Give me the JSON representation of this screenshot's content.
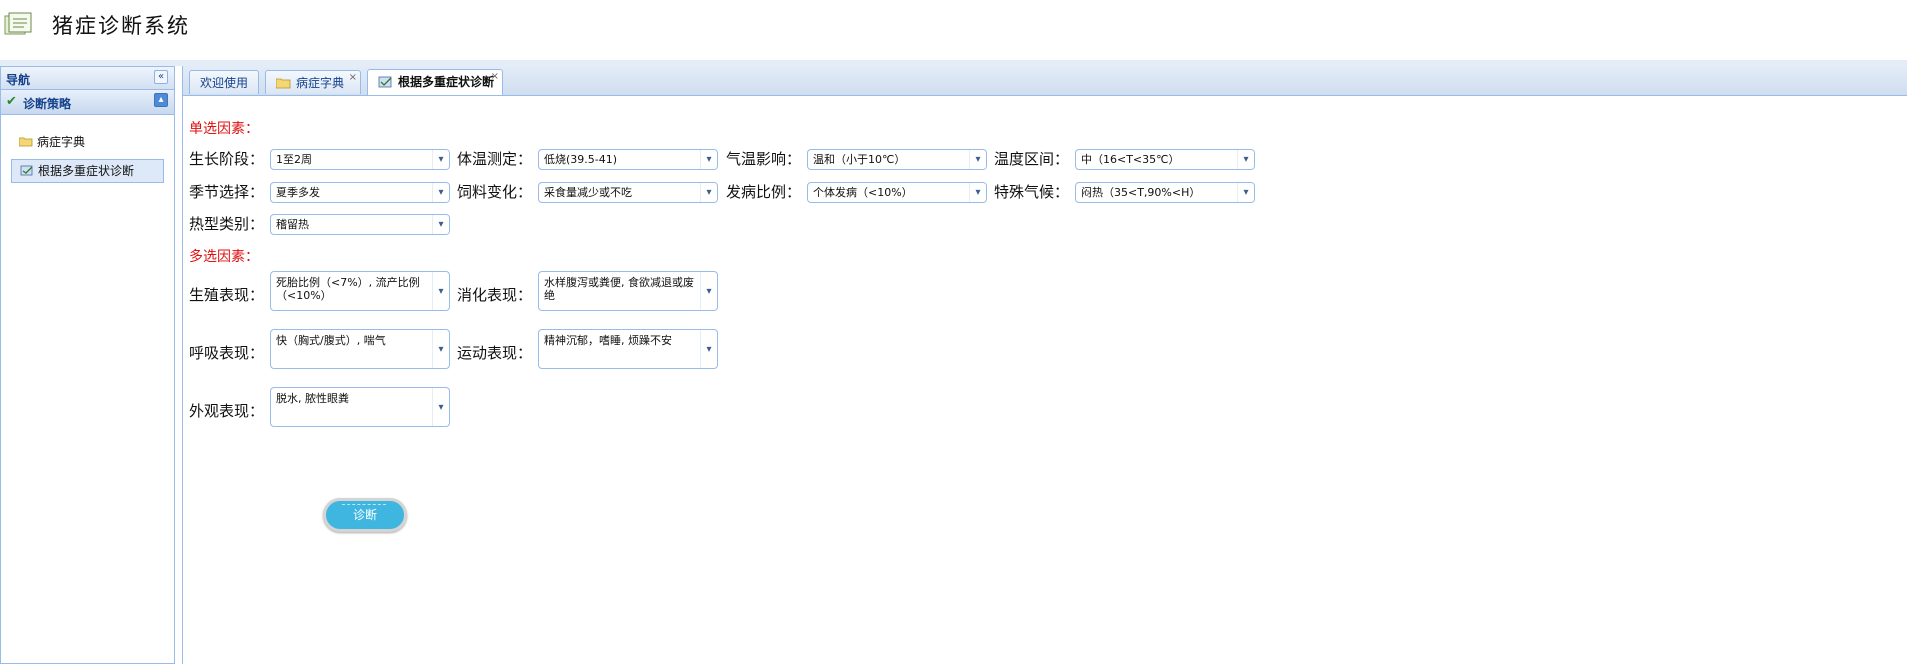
{
  "app": {
    "title": "猪症诊断系统"
  },
  "west": {
    "header": "导航",
    "collapse_icon": "«",
    "accordion_title": "诊断策略",
    "accordion_icon": "▴",
    "items": [
      {
        "label": "病症字典"
      },
      {
        "label": "根据多重症状诊断"
      }
    ]
  },
  "tabs": [
    {
      "label": "欢迎使用"
    },
    {
      "label": "病症字典",
      "close": "×"
    },
    {
      "label": "根据多重症状诊断",
      "close": "×"
    }
  ],
  "form": {
    "single_title": "单选因素：",
    "multi_title": "多选因素：",
    "single": [
      {
        "label": "生长阶段：",
        "value": "1至2周"
      },
      {
        "label": "体温测定：",
        "value": "低烧(39.5-41)"
      },
      {
        "label": "气温影响：",
        "value": "温和（小于10℃）"
      },
      {
        "label": "温度区间：",
        "value": "中（16<T<35℃）"
      },
      {
        "label": "季节选择：",
        "value": "夏季多发"
      },
      {
        "label": "饲料变化：",
        "value": "采食量减少或不吃"
      },
      {
        "label": "发病比例：",
        "value": "个体发病（<10%）"
      },
      {
        "label": "特殊气候：",
        "value": "闷热（35<T,90%<H）"
      },
      {
        "label": "热型类别：",
        "value": "稽留热"
      }
    ],
    "multi": [
      {
        "label": "生殖表现：",
        "value": "死胎比例（<7%）, 流产比例（<10%）"
      },
      {
        "label": "消化表现：",
        "value": "水样腹泻或粪便, 食欲减退或废绝"
      },
      {
        "label": "呼吸表现：",
        "value": "快（胸式/腹式）, 喘气"
      },
      {
        "label": "运动表现：",
        "value": "精神沉郁，嗜睡, 烦躁不安"
      },
      {
        "label": "外观表现：",
        "value": "脱水, 脓性眼粪"
      }
    ],
    "arrow": "▾",
    "diagnose_label": "诊断"
  }
}
